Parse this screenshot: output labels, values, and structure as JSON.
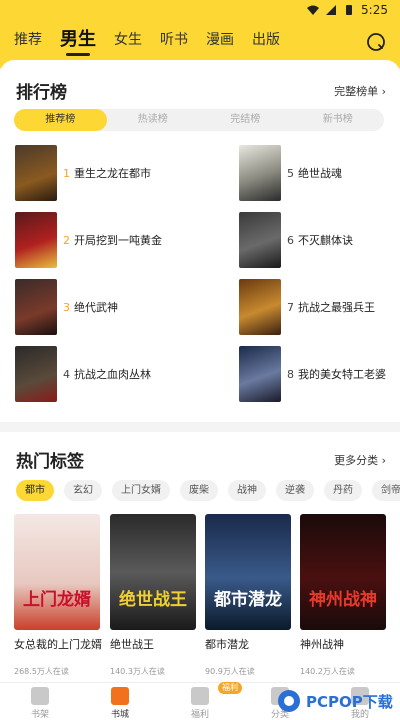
{
  "status_bar": {
    "time": "5:25",
    "icons": [
      "wifi-icon",
      "signal-icon",
      "battery-icon"
    ]
  },
  "header": {
    "tabs": [
      {
        "label": "推荐"
      },
      {
        "label": "男生"
      },
      {
        "label": "女生"
      },
      {
        "label": "听书"
      },
      {
        "label": "漫画"
      },
      {
        "label": "出版"
      }
    ],
    "active_tab": "男生",
    "search_icon": "search-icon"
  },
  "ranking": {
    "title": "排行榜",
    "more_label": "完整榜单 ›",
    "tabs": [
      "推荐榜",
      "热读榜",
      "完结榜",
      "新书榜"
    ],
    "active_tab": "推荐榜",
    "items": [
      {
        "rank": "1",
        "title": "重生之龙在都市"
      },
      {
        "rank": "2",
        "title": "开局挖到一吨黄金"
      },
      {
        "rank": "3",
        "title": "绝代武神"
      },
      {
        "rank": "4",
        "title": "抗战之血肉丛林"
      },
      {
        "rank": "5",
        "title": "绝世战魂"
      },
      {
        "rank": "6",
        "title": "不灭麒体诀"
      },
      {
        "rank": "7",
        "title": "抗战之最强兵王"
      },
      {
        "rank": "8",
        "title": "我的美女特工老婆"
      }
    ]
  },
  "hot_tags": {
    "title": "热门标签",
    "more_label": "更多分类 ›",
    "tags": [
      "都市",
      "玄幻",
      "上门女婿",
      "废柴",
      "战神",
      "逆袭",
      "丹药",
      "剑帝"
    ],
    "active_tag": "都市",
    "books": [
      {
        "title": "女总裁的上门龙婿",
        "cover_text": "上门龙婿",
        "readers": "268.5万人在读"
      },
      {
        "title": "绝世战王",
        "cover_text": "绝世战王",
        "readers": "140.3万人在读"
      },
      {
        "title": "都市潜龙",
        "cover_text": "都市潜龙",
        "readers": "90.9万人在读"
      },
      {
        "title": "神州战神",
        "cover_text": "神州战神",
        "readers": "140.2万人在读"
      }
    ]
  },
  "bottom_nav": {
    "items": [
      {
        "label": "书架",
        "icon": "bookshelf-icon"
      },
      {
        "label": "书城",
        "icon": "bookstore-icon"
      },
      {
        "label": "福利",
        "icon": "gift-icon"
      },
      {
        "label": "分类",
        "icon": "category-icon"
      },
      {
        "label": "我的",
        "icon": "profile-icon"
      }
    ],
    "active": "书城",
    "welfare_badge": "福利"
  },
  "watermark": {
    "text": "PCPOP下载"
  },
  "colors": {
    "accent": "#fdd835",
    "rank_highlight": "#f5a623",
    "active_nav": "#f2711c"
  }
}
